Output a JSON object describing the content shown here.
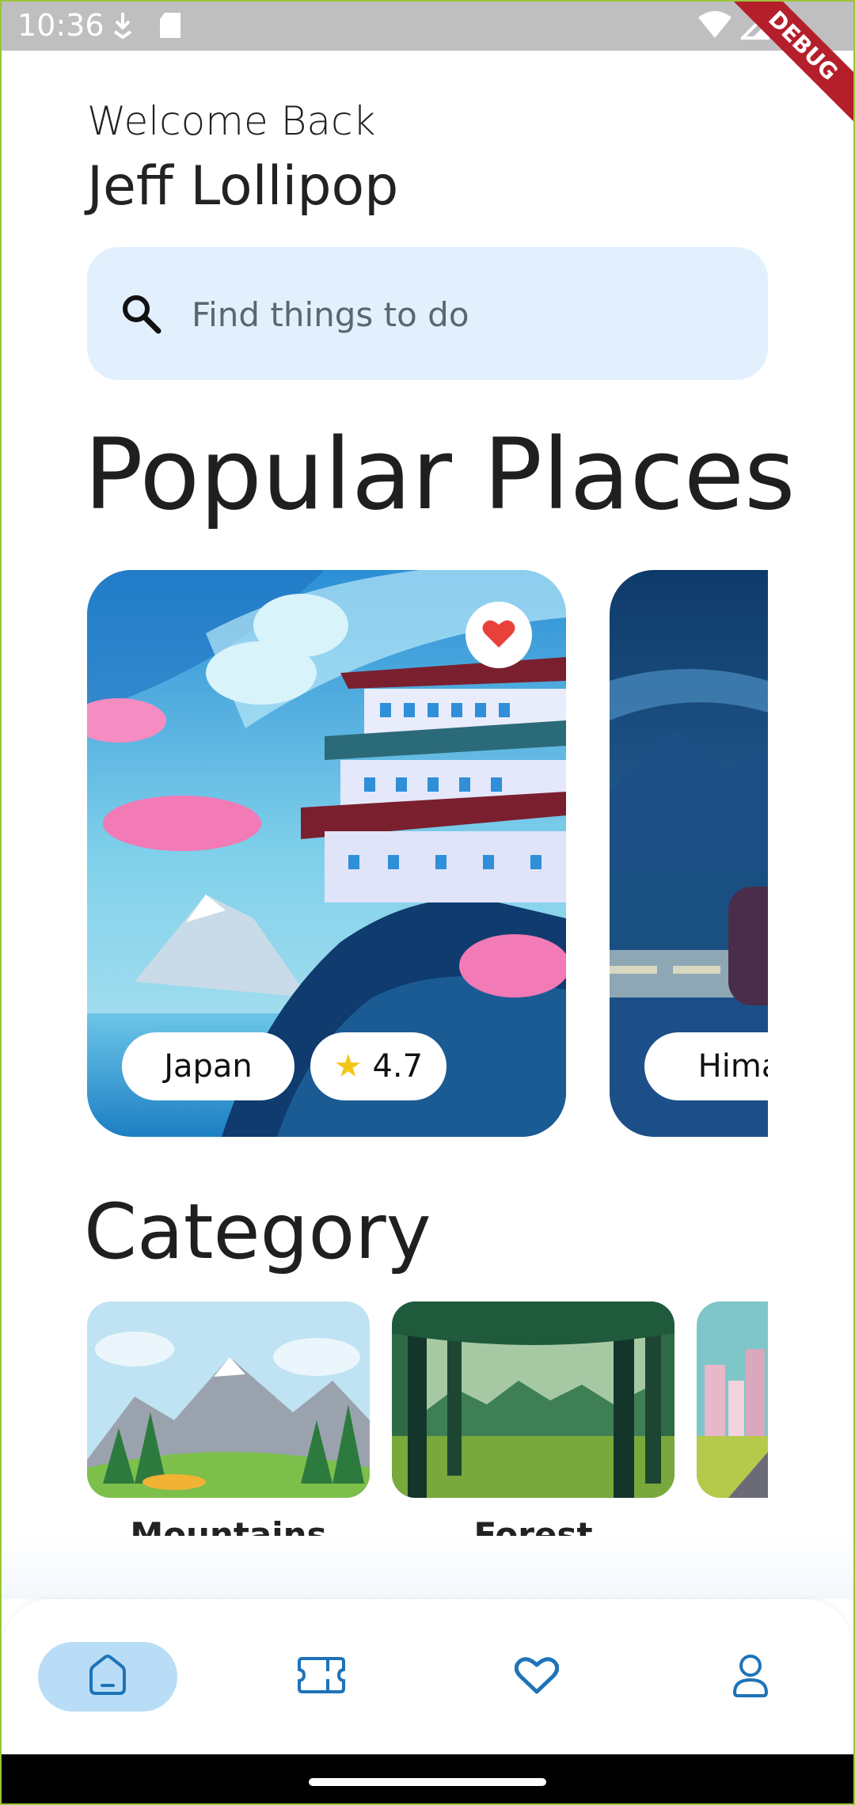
{
  "status_bar": {
    "time": "10:36",
    "icons": [
      "download-icon",
      "sd-card-icon",
      "wifi-icon",
      "signal-icon",
      "battery-icon"
    ],
    "debug_banner": "DEBUG"
  },
  "header": {
    "welcome": "Welcome Back",
    "user_name": "Jeff Lollipop"
  },
  "search": {
    "placeholder": "Find things to do",
    "icon": "search-icon"
  },
  "popular": {
    "title": "Popular Places",
    "places": [
      {
        "name": "Japan",
        "rating": "4.7",
        "favorited": true
      },
      {
        "name": "Hima"
      }
    ]
  },
  "category": {
    "title": "Category",
    "items": [
      {
        "label": "Mountains"
      },
      {
        "label": "Forest"
      },
      {
        "label": ""
      }
    ]
  },
  "bottom_nav": {
    "items": [
      {
        "id": "home",
        "icon": "home-icon",
        "active": true
      },
      {
        "id": "tickets",
        "icon": "ticket-icon",
        "active": false
      },
      {
        "id": "favorites",
        "icon": "heart-icon",
        "active": false
      },
      {
        "id": "profile",
        "icon": "person-icon",
        "active": false
      }
    ]
  },
  "colors": {
    "accent": "#1e73b8",
    "search_bg": "#e2f0fd",
    "nav_active_bg": "#b9ddf6",
    "favorite": "#e8413a",
    "star": "#f5c518"
  }
}
